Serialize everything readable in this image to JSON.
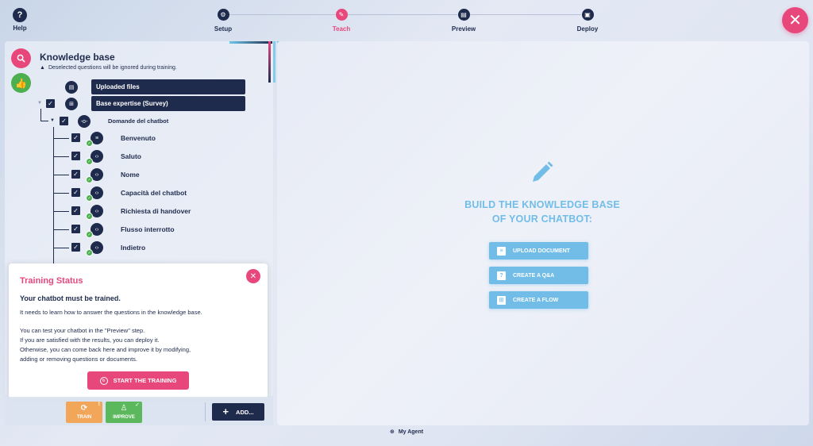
{
  "topbar": {
    "help_label": "Help",
    "steps": [
      {
        "label": "Setup",
        "icon": "gear-icon"
      },
      {
        "label": "Teach",
        "icon": "pencil-icon"
      },
      {
        "label": "Preview",
        "icon": "chat-icon"
      },
      {
        "label": "Deploy",
        "icon": "deploy-icon"
      }
    ],
    "active_step": "Teach"
  },
  "sidebar": {
    "title": "Knowledge base",
    "warning": "Deselected questions will be ignored during training.",
    "uploaded_files_label": "Uploaded files",
    "base_expertise_label": "Base expertise (Survey)",
    "flow_label": "Domande del chatbot",
    "items": [
      {
        "label": "Benvenuto",
        "checked": true,
        "icon": "text-icon"
      },
      {
        "label": "Saluto",
        "checked": true,
        "icon": "code-icon"
      },
      {
        "label": "Nome",
        "checked": true,
        "icon": "code-icon"
      },
      {
        "label": "Capacità del chatbot",
        "checked": true,
        "icon": "code-icon"
      },
      {
        "label": "Richiesta di handover",
        "checked": true,
        "icon": "code-icon"
      },
      {
        "label": "Flusso interrotto",
        "checked": true,
        "icon": "code-icon"
      },
      {
        "label": "Indietro",
        "checked": true,
        "icon": "code-icon"
      }
    ]
  },
  "training": {
    "title": "Training Status",
    "subtitle": "Your chatbot must be trained.",
    "p1": "It needs to learn how to answer the questions in the knowledge base.",
    "p2_line1": "You can test your chatbot in the \"Preview\" step.",
    "p2_line2": "If you are satisfied with the results, you can deploy it.",
    "p2_line3": "Otherwise, you can come back here and improve it by modifying,",
    "p2_line4": "adding or removing questions or documents.",
    "start_label": "START THE TRAINING"
  },
  "toolbar": {
    "train_label": "TRAIN",
    "train_mark": "!",
    "improve_label": "IMPROVE",
    "improve_mark": "✓",
    "add_label": "ADD..."
  },
  "main": {
    "title_line1": "BUILD THE KNOWLEDGE BASE",
    "title_line2": "OF YOUR CHATBOT:",
    "upload_label": "UPLOAD DOCUMENT",
    "qa_label": "CREATE A Q&A",
    "flow_label": "CREATE A FLOW"
  },
  "footer": {
    "agent_label": "My Agent"
  },
  "colors": {
    "accent": "#e8477c",
    "navy": "#1f2b4d",
    "light_blue": "#72bde8",
    "green": "#4caf50",
    "orange": "#f2a65a"
  }
}
